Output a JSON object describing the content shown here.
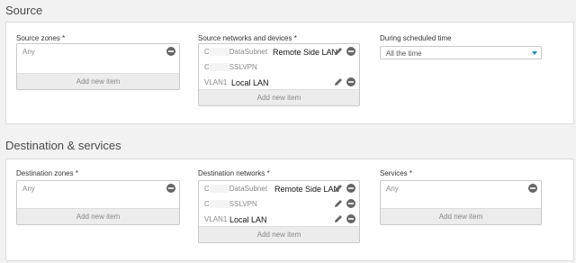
{
  "source": {
    "title": "Source",
    "zones": {
      "label": "Source zones *",
      "items": [
        "Any"
      ],
      "add_label": "Add new item"
    },
    "networks": {
      "label": "Source networks and devices *",
      "items": [
        {
          "prefix": "C",
          "value": "DataSubnet",
          "overlay": "Remote Side LAN"
        },
        {
          "prefix": "C",
          "value": "SSLVPN",
          "overlay": ""
        },
        {
          "prefix": "VLAN1",
          "value": "",
          "overlay": "Local LAN"
        }
      ],
      "add_label": "Add new item"
    },
    "schedule": {
      "label": "During scheduled time",
      "value": "All the time"
    }
  },
  "destination": {
    "title": "Destination & services",
    "zones": {
      "label": "Destination zones *",
      "items": [
        "Any"
      ],
      "add_label": "Add new item"
    },
    "networks": {
      "label": "Destination networks *",
      "items": [
        {
          "prefix": "C",
          "value": "DataSubnet",
          "overlay": "Remote Side LAN"
        },
        {
          "prefix": "C",
          "value": "SSLVPN",
          "overlay": ""
        },
        {
          "prefix": "VLAN1",
          "value": "",
          "overlay": "Local LAN"
        }
      ],
      "add_label": "Add new item"
    },
    "services": {
      "label": "Services *",
      "items": [
        "Any"
      ],
      "add_label": "Add new item"
    }
  },
  "colors": {
    "accent": "#1a8ac9",
    "icon": "#666666"
  }
}
